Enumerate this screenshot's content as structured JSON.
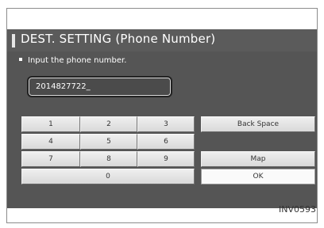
{
  "title": "DEST. SETTING (Phone Number)",
  "instruction": "Input the phone number.",
  "phone_number": {
    "value": "2014827722_"
  },
  "keypad": {
    "keys": [
      "1",
      "2",
      "3",
      "4",
      "5",
      "6",
      "7",
      "8",
      "9",
      "0"
    ]
  },
  "actions": {
    "back_space": "Back Space",
    "map": "Map",
    "ok": "OK"
  },
  "image_id": "INV0593"
}
